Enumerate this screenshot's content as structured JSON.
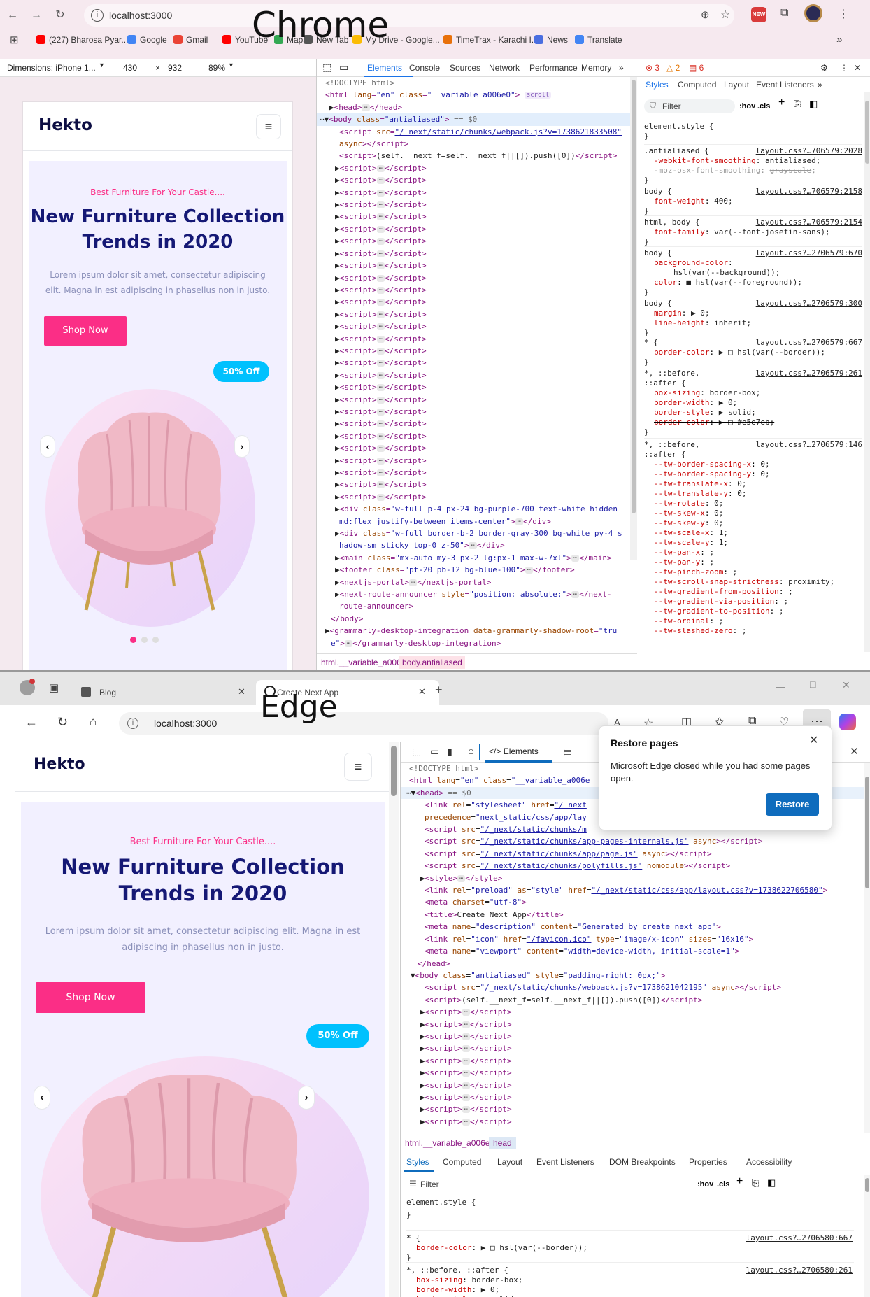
{
  "chrome": {
    "label": "Chrome",
    "url": "localhost:3000",
    "bookmarks": [
      {
        "label": "(227) Bharosa Pyar...",
        "color": "#ff0000"
      },
      {
        "label": "Google",
        "color": "#4285f4"
      },
      {
        "label": "Gmail",
        "color": "#ea4335"
      },
      {
        "label": "YouTube",
        "color": "#ff0000"
      },
      {
        "label": "Maps",
        "color": "#34a853"
      },
      {
        "label": "New Tab",
        "color": "#555555"
      },
      {
        "label": "My Drive - Google...",
        "color": "#fbbc04"
      },
      {
        "label": "TimeTrax - Karachi I...",
        "color": "#e8710a"
      },
      {
        "label": "News",
        "color": "#4a6ee0"
      },
      {
        "label": "Translate",
        "color": "#4285f4"
      }
    ],
    "device": {
      "dimensions": "Dimensions: iPhone 1...",
      "width": "430",
      "x": "×",
      "height": "932",
      "zoom": "89%"
    },
    "devtools": {
      "tabs": [
        "Elements",
        "Console",
        "Sources",
        "Network",
        "Performance",
        "Memory"
      ],
      "errors": "3",
      "warnings": "2",
      "issues": "6",
      "styles_tabs": [
        "Styles",
        "Computed",
        "Layout",
        "Event Listeners"
      ],
      "filter_placeholder": "Filter",
      "hov": ":hov",
      "cls": ".cls",
      "crumbs": [
        "html.__variable_a006e0",
        "body.antialiased"
      ]
    }
  },
  "hekto": {
    "logo": "Hekto",
    "tagline": "Best Furniture For Your Castle....",
    "title_line1": "New Furniture Collection",
    "title_line2": "Trends in 2020",
    "description": "Lorem ipsum dolor sit amet, consectetur adipiscing elit. Magna in est adipiscing in phasellus non in justo.",
    "shop_button": "Shop Now",
    "discount": "50% Off",
    "slide_count": 3,
    "active_slide": 1,
    "menu_icon": "hamburger-icon",
    "prev_icon": "chevron-left-icon",
    "next_icon": "chevron-right-icon"
  },
  "edge": {
    "label": "Edge",
    "url": "localhost:3000",
    "tabs": [
      "Blog",
      "Create Next App"
    ],
    "devtools_tab": "Elements",
    "restore": {
      "title": "Restore pages",
      "message": "Microsoft Edge closed while you had some pages open.",
      "button": "Restore"
    },
    "crumbs": [
      "html.__variable_a006e0",
      "head"
    ],
    "styles_tabs": [
      "Styles",
      "Computed",
      "Layout",
      "Event Listeners",
      "DOM Breakpoints",
      "Properties",
      "Accessibility"
    ],
    "filter_placeholder": "Filter",
    "hov": ":hov",
    "cls": ".cls"
  },
  "colors": {
    "hekto_pink": "#fb2e86",
    "hekto_navy": "#151875",
    "hekto_blue_badge": "#00c1fe",
    "devtools_blue": "#1a73e8",
    "edge_restore_blue": "#0f6cbd"
  }
}
